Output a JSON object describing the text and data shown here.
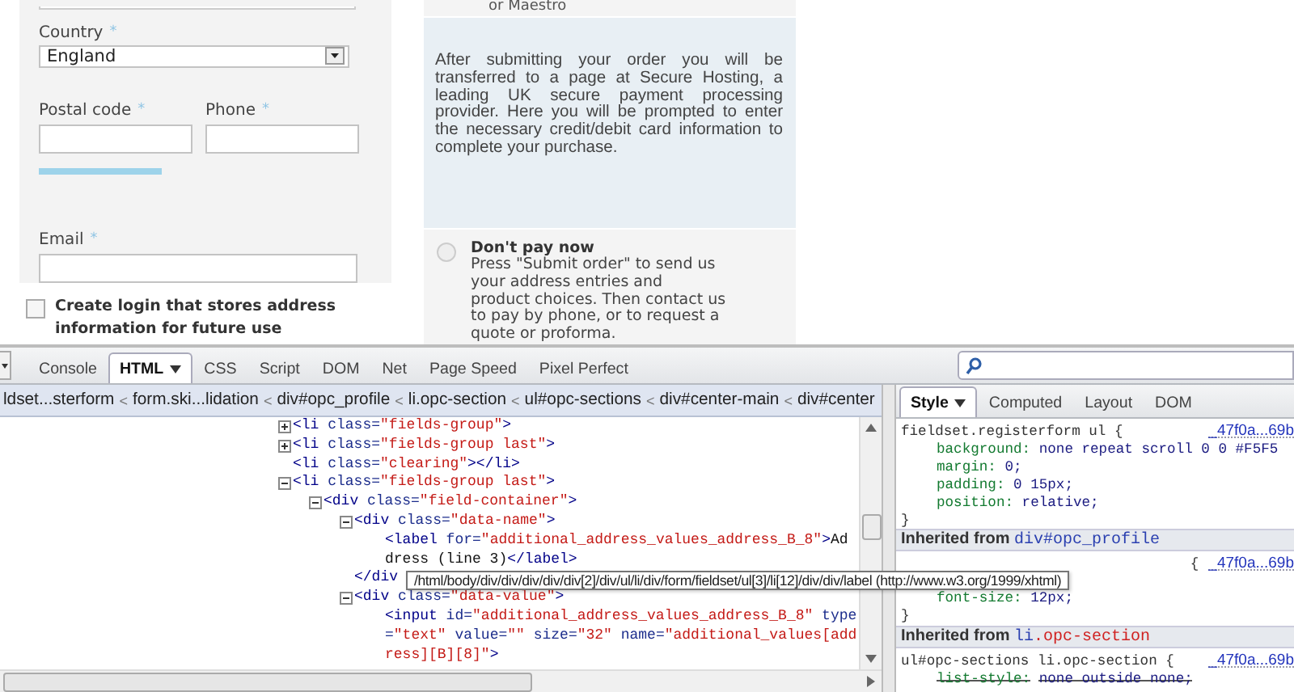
{
  "form": {
    "country": {
      "label": "Country",
      "required_mark": "*",
      "value": "England"
    },
    "postal_code": {
      "label": "Postal code",
      "required_mark": "*"
    },
    "phone": {
      "label": "Phone",
      "required_mark": "*"
    },
    "email": {
      "label": "Email",
      "required_mark": "*"
    },
    "create_login": {
      "label": "Create login that stores address information for future use",
      "checked": false
    }
  },
  "payment": {
    "previous_option_tail": "or Maestro",
    "card_info": "After submitting your order you will be transferred to a page at Secure Hosting, a leading UK secure payment processing provider. Here you will be prompted to enter the necessary credit/debit card information to complete your purchase.",
    "pay_later": {
      "title": "Don't pay now",
      "description": "Press \"Submit order\" to send us your address entries and product choices. Then contact us to pay by phone, or to request a quote or proforma.",
      "selected": false
    }
  },
  "devtools": {
    "tabs": [
      {
        "label": "Console",
        "selected": false,
        "menu": false
      },
      {
        "label": "HTML",
        "selected": true,
        "menu": true
      },
      {
        "label": "CSS",
        "selected": false,
        "menu": false
      },
      {
        "label": "Script",
        "selected": false,
        "menu": false
      },
      {
        "label": "DOM",
        "selected": false,
        "menu": false
      },
      {
        "label": "Net",
        "selected": false,
        "menu": false
      },
      {
        "label": "Page Speed",
        "selected": false,
        "menu": false
      },
      {
        "label": "Pixel Perfect",
        "selected": false,
        "menu": false
      }
    ],
    "breadcrumbs": [
      {
        "kind": "crumb",
        "text": "ldset...sterform"
      },
      {
        "kind": "separator",
        "text": "<"
      },
      {
        "kind": "crumb",
        "text": "form.ski...lidation"
      },
      {
        "kind": "separator",
        "text": "<"
      },
      {
        "kind": "crumb",
        "text": "div#opc_profile"
      },
      {
        "kind": "separator",
        "text": "<"
      },
      {
        "kind": "crumb",
        "text": "li.opc-section"
      },
      {
        "kind": "separator",
        "text": "<"
      },
      {
        "kind": "crumb",
        "text": "ul#opc-sections"
      },
      {
        "kind": "separator",
        "text": "<"
      },
      {
        "kind": "crumb",
        "text": "div#center-main"
      },
      {
        "kind": "separator",
        "text": "<"
      },
      {
        "kind": "crumb",
        "text": "div#center"
      }
    ],
    "html_tree": [
      {
        "expanded": false,
        "lines": [
          [
            {
              "kind": "tag",
              "text": "<li"
            },
            {
              "kind": "attr",
              "text": " class="
            },
            {
              "kind": "value",
              "text": "\"fields-group\""
            },
            {
              "kind": "tag",
              "text": ">"
            }
          ]
        ]
      },
      {
        "expanded": false,
        "lines": [
          [
            {
              "kind": "tag",
              "text": "<li"
            },
            {
              "kind": "attr",
              "text": " class="
            },
            {
              "kind": "value",
              "text": "\"fields-group last\""
            },
            {
              "kind": "tag",
              "text": ">"
            }
          ]
        ]
      },
      {
        "lines": [
          [
            {
              "kind": "tag",
              "text": "<li"
            },
            {
              "kind": "attr",
              "text": " class="
            },
            {
              "kind": "value",
              "text": "\"clearing\""
            },
            {
              "kind": "tag",
              "text": "></li>"
            }
          ]
        ]
      },
      {
        "expanded": true,
        "lines": [
          [
            {
              "kind": "tag",
              "text": "<li"
            },
            {
              "kind": "attr",
              "text": " class="
            },
            {
              "kind": "value",
              "text": "\"fields-group last\""
            },
            {
              "kind": "tag",
              "text": ">"
            }
          ]
        ],
        "children": [
          {
            "expanded": true,
            "lines": [
              [
                {
                  "kind": "tag",
                  "text": "<div"
                },
                {
                  "kind": "attr",
                  "text": " class="
                },
                {
                  "kind": "value",
                  "text": "\"field-container\""
                },
                {
                  "kind": "tag",
                  "text": ">"
                }
              ]
            ],
            "children": [
              {
                "expanded": true,
                "lines": [
                  [
                    {
                      "kind": "tag",
                      "text": "<div"
                    },
                    {
                      "kind": "attr",
                      "text": " class="
                    },
                    {
                      "kind": "value",
                      "text": "\"data-name\""
                    },
                    {
                      "kind": "tag",
                      "text": ">"
                    }
                  ]
                ],
                "children": [
                  {
                    "lines": [
                      [
                        {
                          "kind": "tag",
                          "text": "<label"
                        },
                        {
                          "kind": "attr",
                          "text": " for="
                        },
                        {
                          "kind": "value",
                          "text": "\"additional_address_values_address_B_8\""
                        },
                        {
                          "kind": "tag",
                          "text": ">"
                        },
                        {
                          "kind": "text",
                          "text": "Ad"
                        }
                      ],
                      [
                        {
                          "kind": "text",
                          "text": "dress (line 3)"
                        },
                        {
                          "kind": "tag",
                          "text": "</label>"
                        }
                      ]
                    ]
                  }
                ],
                "closing": [
                  [
                    {
                      "kind": "tag",
                      "text": "</div"
                    }
                  ]
                ]
              },
              {
                "expanded": true,
                "lines": [
                  [
                    {
                      "kind": "tag",
                      "text": "<div"
                    },
                    {
                      "kind": "attr",
                      "text": " class="
                    },
                    {
                      "kind": "value",
                      "text": "\"data-value\""
                    },
                    {
                      "kind": "tag",
                      "text": ">"
                    }
                  ]
                ],
                "children": [
                  {
                    "lines": [
                      [
                        {
                          "kind": "tag",
                          "text": "<input"
                        },
                        {
                          "kind": "attr",
                          "text": " id="
                        },
                        {
                          "kind": "value",
                          "text": "\"additional_address_values_address_B_8\""
                        },
                        {
                          "kind": "attr",
                          "text": " type"
                        }
                      ],
                      [
                        {
                          "kind": "attr",
                          "text": "="
                        },
                        {
                          "kind": "value",
                          "text": "\"text\""
                        },
                        {
                          "kind": "attr",
                          "text": " value="
                        },
                        {
                          "kind": "value",
                          "text": "\"\""
                        },
                        {
                          "kind": "attr",
                          "text": " size="
                        },
                        {
                          "kind": "value",
                          "text": "\"32\""
                        },
                        {
                          "kind": "attr",
                          "text": " name="
                        },
                        {
                          "kind": "value",
                          "text": "\"additional_values[add"
                        }
                      ],
                      [
                        {
                          "kind": "value",
                          "text": "ress][B][8]\""
                        },
                        {
                          "kind": "tag",
                          "text": ">"
                        }
                      ]
                    ]
                  }
                ]
              }
            ]
          }
        ]
      }
    ],
    "tooltip": "/html/body/div/div/div/div/div[2]/div/ul/li/div/form/fieldset/ul[3]/li[12]/div/div/label (http://www.w3.org/1999/xhtml)",
    "side_tabs": [
      {
        "label": "Style",
        "selected": true,
        "menu": true
      },
      {
        "label": "Computed",
        "selected": false,
        "menu": false
      },
      {
        "label": "Layout",
        "selected": false,
        "menu": false
      },
      {
        "label": "DOM",
        "selected": false,
        "menu": false
      }
    ],
    "style_sections": [
      {
        "kind": "rule",
        "selector": "fieldset.registerform ul {",
        "source": "_47f0a...69b",
        "covered": false,
        "close": "}",
        "properties": [
          {
            "name": "background:",
            "value": "none repeat scroll 0 0 #F5F5",
            "overridden": false
          },
          {
            "name": "margin:",
            "value": "0;",
            "overridden": false
          },
          {
            "name": "padding:",
            "value": "0 15px;",
            "overridden": false
          },
          {
            "name": "position:",
            "value": "relative;",
            "overridden": false
          }
        ]
      },
      {
        "kind": "inherited",
        "label": "Inherited from",
        "selector": [
          {
            "kind": "element",
            "text": "div#opc_profile"
          }
        ]
      },
      {
        "kind": "rule",
        "selector": "{",
        "source": "_47f0a...69b",
        "covered": true,
        "close": "}",
        "properties": [
          {
            "name": "font-size:",
            "value": "12px;",
            "overridden": false
          }
        ]
      },
      {
        "kind": "inherited",
        "label": "Inherited from",
        "selector": [
          {
            "kind": "element",
            "text": "li"
          },
          {
            "kind": "class",
            "text": ".opc-section"
          }
        ]
      },
      {
        "kind": "rule",
        "selector": "ul#opc-sections li.opc-section {",
        "source": "_47f0a...69b",
        "covered": false,
        "properties": [
          {
            "name": "list-style:",
            "value": "none outside none;",
            "overridden": true
          }
        ]
      }
    ]
  }
}
